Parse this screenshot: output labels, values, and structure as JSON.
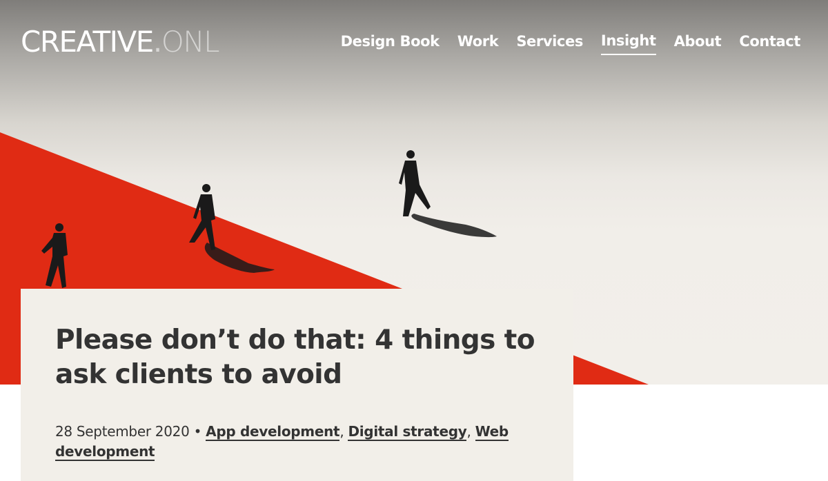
{
  "logo": {
    "bold": "CREATIVE",
    "dot": ".",
    "light": "ONL"
  },
  "nav": {
    "items": [
      {
        "label": "Design Book"
      },
      {
        "label": "Work"
      },
      {
        "label": "Services"
      },
      {
        "label": "Insight",
        "active": true
      },
      {
        "label": "About"
      },
      {
        "label": "Contact"
      }
    ]
  },
  "article": {
    "title": "Please don’t do that: 4 things to ask clients to avoid",
    "date": "28 September 2020",
    "separator": " • ",
    "categories": [
      {
        "label": "App development"
      },
      {
        "label": "Digital strategy"
      },
      {
        "label": "Web development"
      }
    ]
  },
  "hero": {
    "image": "walking-silhouettes-illustration",
    "accent_color": "#e02b14",
    "figure_color": "#1a1a1a"
  }
}
